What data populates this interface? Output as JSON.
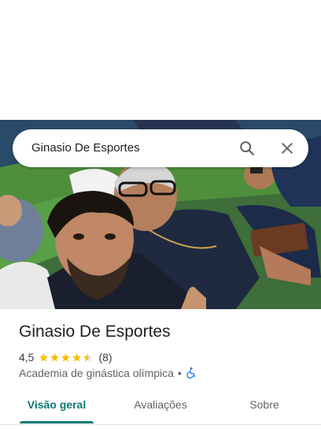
{
  "search": {
    "query": "Ginasio De Esportes",
    "search_icon": "search-icon",
    "close_icon": "close-icon"
  },
  "photo": {
    "description_icon": "place-photo"
  },
  "place": {
    "name": "Ginasio De Esportes",
    "rating": "4,5",
    "rating_numeric": 4.5,
    "stars_max": 5,
    "review_count": "(8)",
    "category": "Academia de ginástica olímpica",
    "separator": "•",
    "accessibility_icon": "wheelchair-accessible-icon"
  },
  "tabs": [
    {
      "label": "Visão geral",
      "active": true
    },
    {
      "label": "Avaliações",
      "active": false
    },
    {
      "label": "Sobre",
      "active": false
    }
  ],
  "colors": {
    "accent": "#0b7a75",
    "star": "#fbbc04",
    "accessibility": "#1a73e8"
  }
}
